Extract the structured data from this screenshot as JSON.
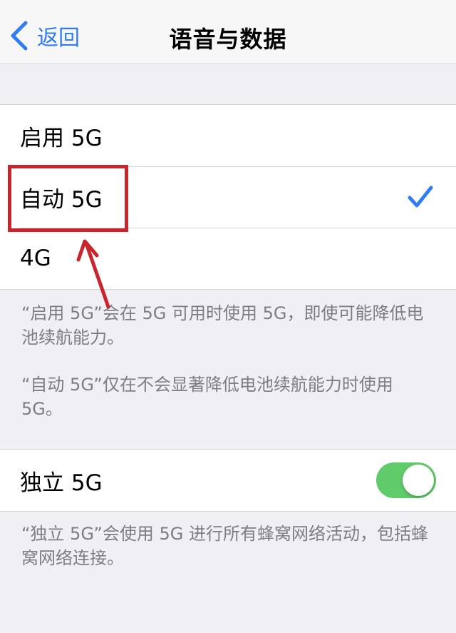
{
  "navbar": {
    "back_label": "返回",
    "title": "语音与数据"
  },
  "options": [
    {
      "label": "启用 5G",
      "selected": false
    },
    {
      "label": "自动 5G",
      "selected": true
    },
    {
      "label": "4G",
      "selected": false
    }
  ],
  "options_footer": {
    "note1": "“启用 5G”会在 5G 可用时使用 5G，即使可能降低电池续航能力。",
    "note2": "“自动 5G”仅在不会显著降低电池续航能力时使用 5G。"
  },
  "standalone": {
    "label": "独立 5G",
    "toggle_on": true,
    "footer": "“独立 5G”会使用 5G 进行所有蜂窝网络活动，包括蜂窝网络连接。"
  },
  "colors": {
    "accent": "#2f7cf6",
    "toggle_on": "#5fcb6a",
    "annotation": "#c9262b",
    "background": "#efeff4"
  }
}
